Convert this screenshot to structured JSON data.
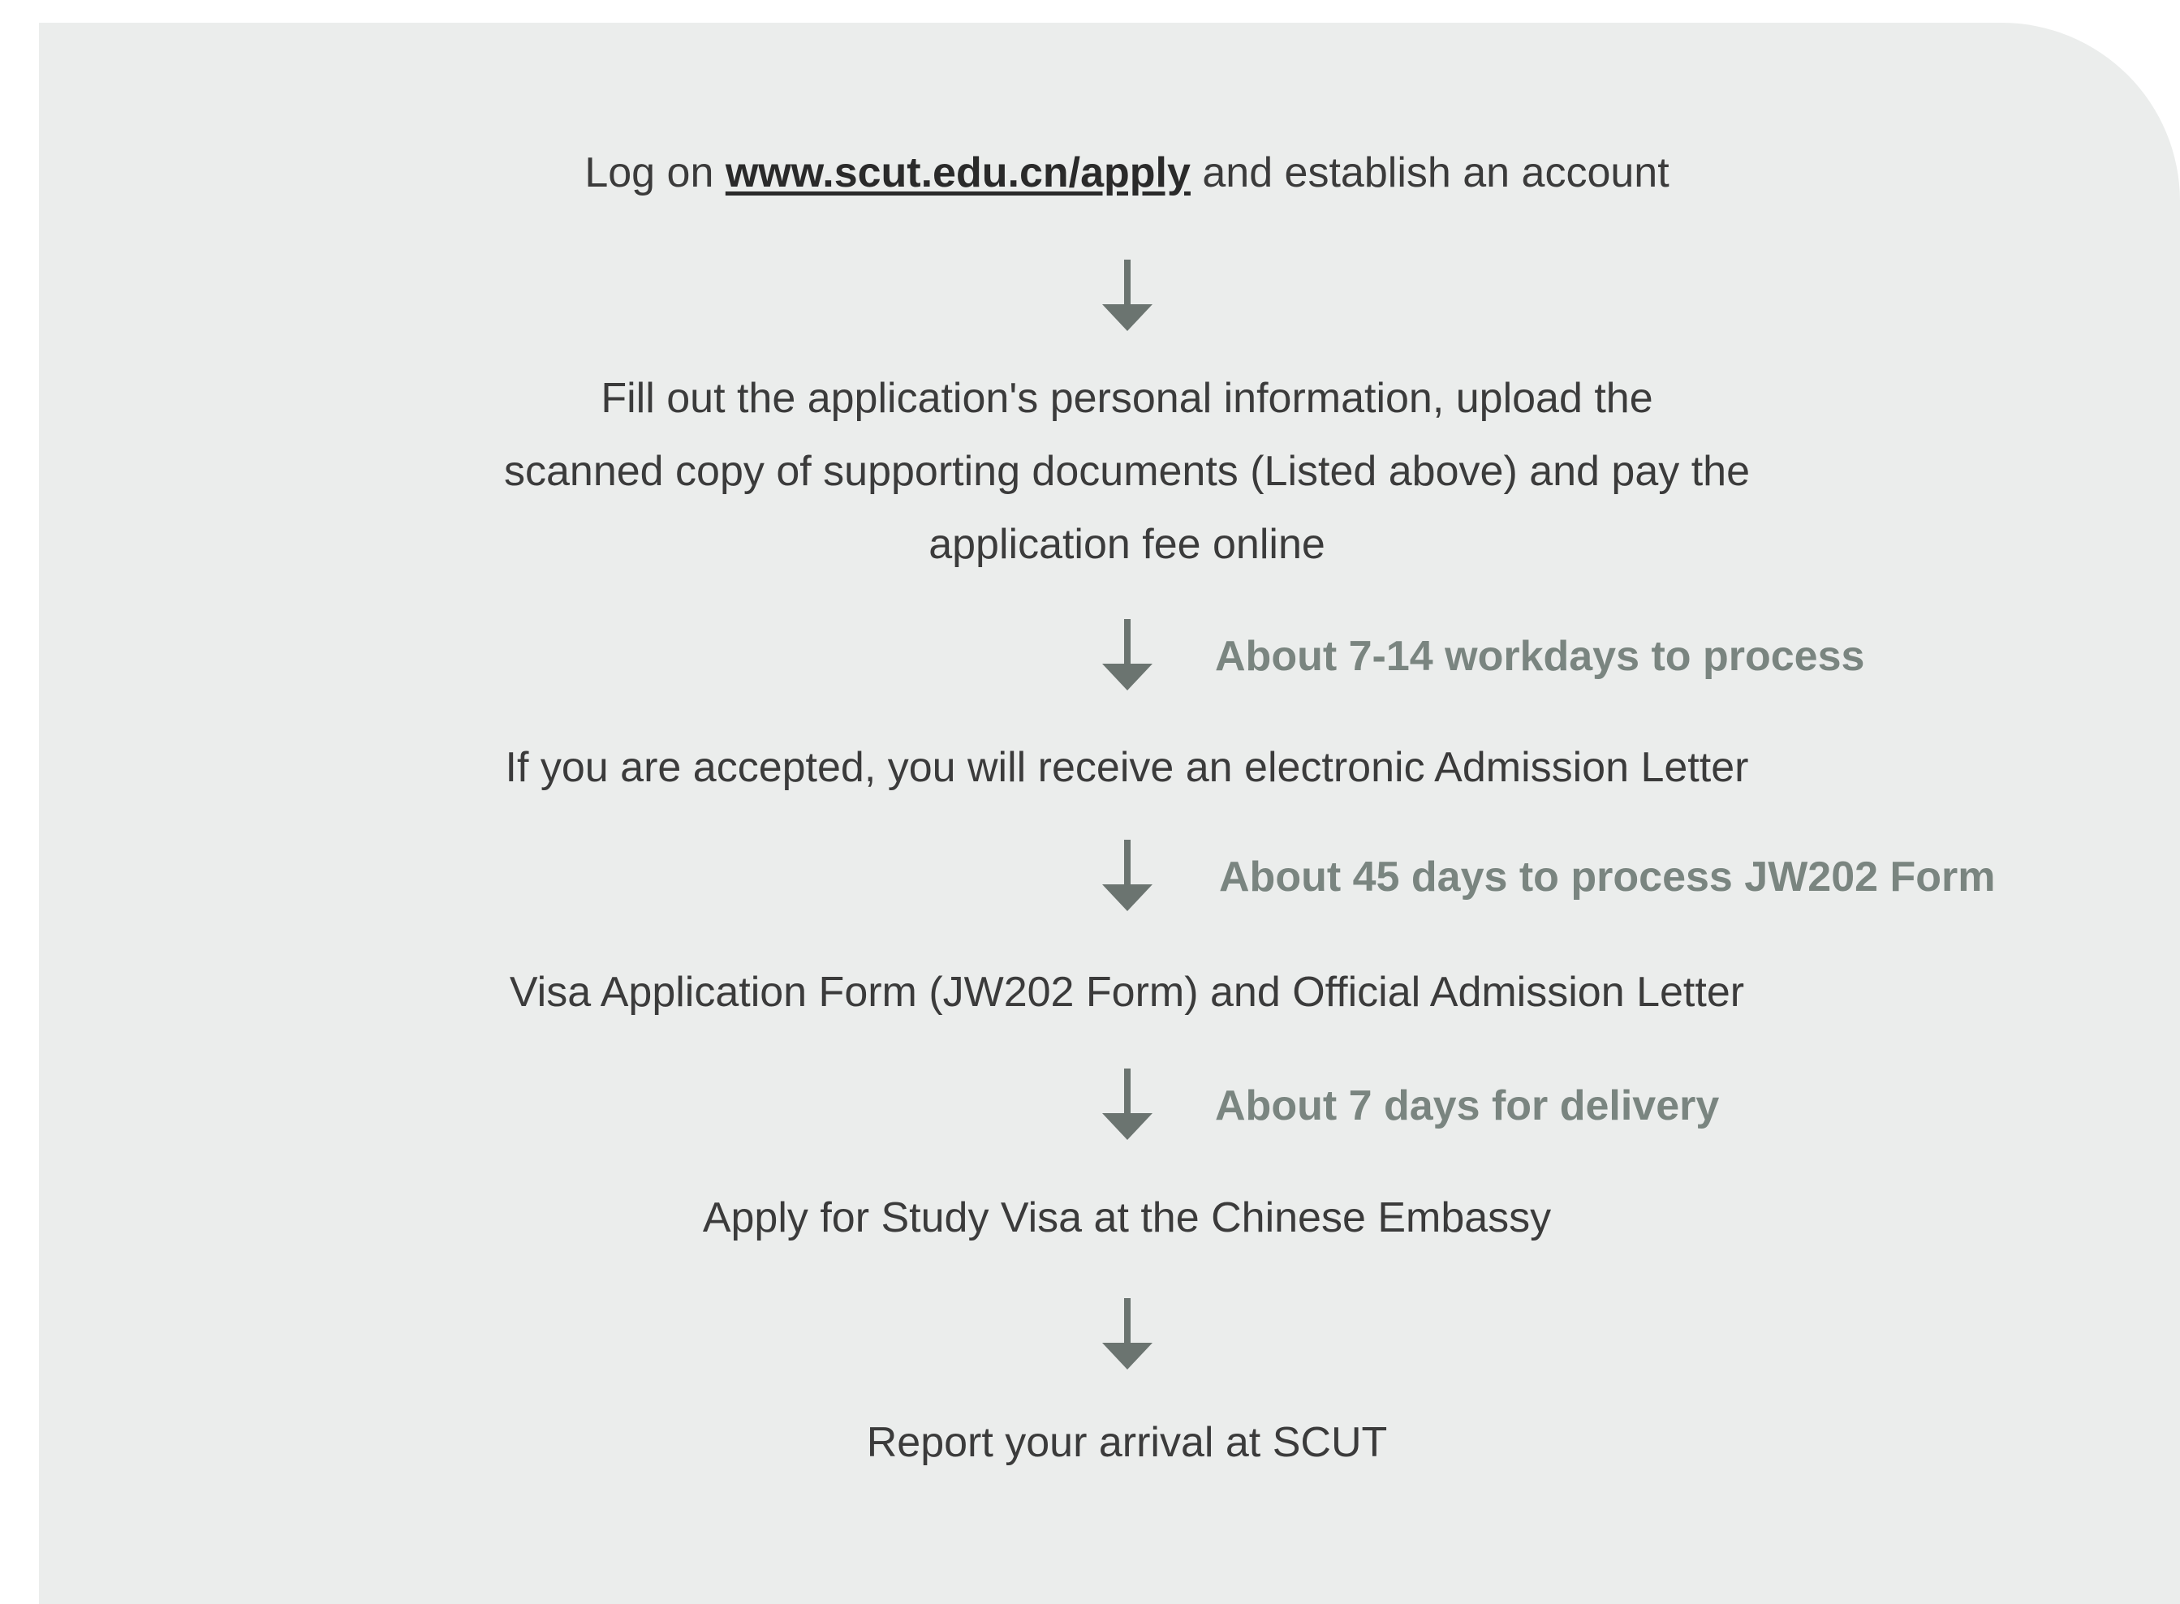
{
  "steps": {
    "step1": {
      "prefix": "Log on ",
      "link": "www.scut.edu.cn/apply",
      "suffix": " and establish an account"
    },
    "step2": {
      "line1": "Fill out the application's personal information, upload the",
      "line2": "scanned copy of supporting documents (Listed above) and pay the",
      "line3": "application fee online"
    },
    "step3": "If you are accepted, you will receive an electronic Admission Letter",
    "step4": "Visa Application Form (JW202 Form) and Official Admission Letter",
    "step5": "Apply for Study Visa at the Chinese Embassy",
    "step6": "Report your arrival at SCUT"
  },
  "notes": {
    "note1": "About 7-14 workdays to process",
    "note2": "About 45 days to process JW202 Form",
    "note3": "About 7 days for delivery"
  },
  "colors": {
    "panel_background": "#ebedec",
    "step_text": "#3b3b3b",
    "note_text": "#7a8580",
    "arrow": "#6b7470"
  },
  "icons": {
    "arrow": "arrow-down-icon"
  }
}
